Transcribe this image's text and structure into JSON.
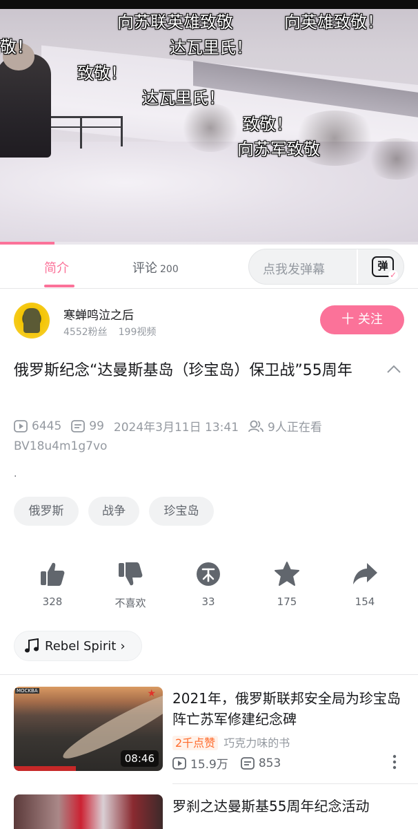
{
  "player": {
    "progress_fraction": 0.13,
    "danmaku": [
      "向苏联英雄致敬",
      "向英雄致敬！",
      "致敬！",
      "达瓦里氏！",
      "致敬！",
      "达瓦里氏！",
      "致敬！",
      "向苏军致敬"
    ]
  },
  "tabs": {
    "intro": "简介",
    "comments": "评论",
    "comments_count": "200",
    "danmaku_placeholder": "点我发弹幕",
    "danmaku_button": "弹"
  },
  "uploader": {
    "name": "寒蝉鸣泣之后",
    "followers": "4552粉丝",
    "videos": "199视频",
    "follow_button": "十 关注"
  },
  "video": {
    "title": "俄罗斯纪念“达曼斯基岛（珍宝岛）保卫战”55周年",
    "views": "6445",
    "danmaku_count": "99",
    "date": "2024年3月11日 13:41",
    "watching": "9人正在看",
    "bvid": "BV18u4m1g7vo",
    "description": "."
  },
  "tags": [
    "俄罗斯",
    "战争",
    "珍宝岛"
  ],
  "actions": {
    "like": "328",
    "dislike": "不喜欢",
    "coin": "33",
    "favorite": "175",
    "share": "154"
  },
  "music": {
    "label": "Rebel Spirit"
  },
  "related": [
    {
      "title": "2021年，俄罗斯联邦安全局为珍宝岛阵亡苏军修建纪念碑",
      "likes_badge": "2千点赞",
      "author": "巧克力味的书",
      "views": "15.9万",
      "danmaku": "853",
      "duration": "08:46",
      "thumb_label": "MOCKBA"
    },
    {
      "title": "罗刹之达曼斯基55周年纪念活动"
    }
  ],
  "colors": {
    "accent": "#fb7299",
    "muted": "#9499a0"
  }
}
